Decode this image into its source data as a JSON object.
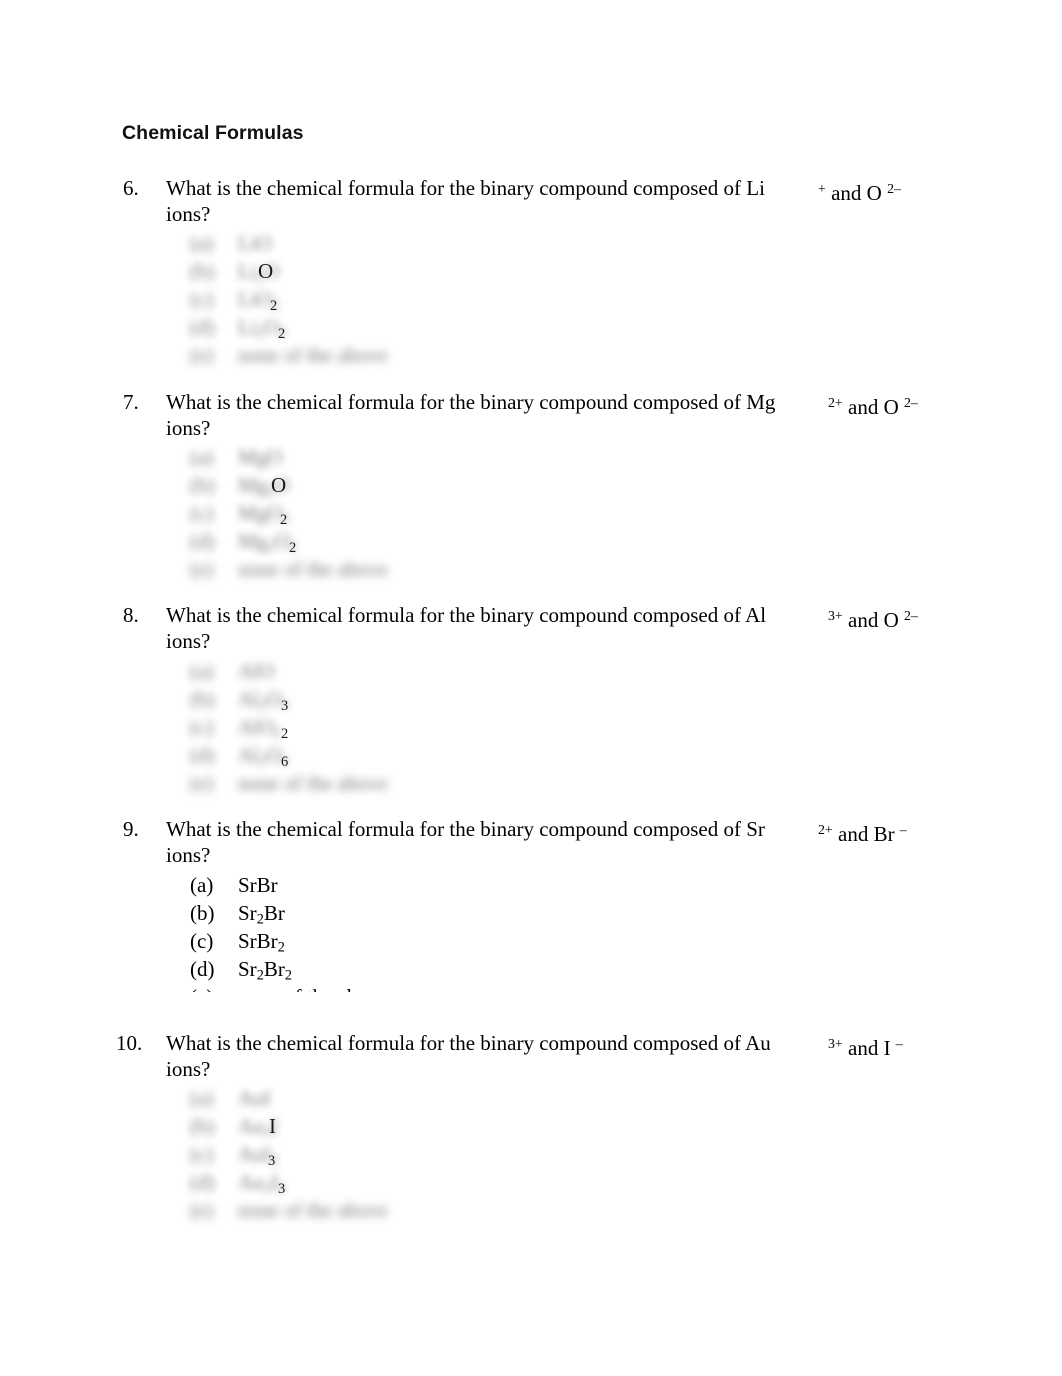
{
  "document": {
    "title": "Chemical Formulas",
    "background_color": "#ffffff",
    "text_color": "#000000"
  },
  "questions": [
    {
      "number": "6.",
      "prompt_line1": "What is the chemical formula for the binary compound composed of Li",
      "prompt_line2": "ions?",
      "ion_cation_symbol": "Li",
      "ion_cation_charge": "+",
      "ion_conjunction": "and O",
      "ion_anion_charge": "2–",
      "ions_text": "+ and O 2–",
      "options": [
        {
          "label": "(a)",
          "value": "LiO",
          "redacted": true,
          "sharp": ""
        },
        {
          "label": "(b)",
          "value": "Li2O",
          "redacted": true,
          "sharp": "O"
        },
        {
          "label": "(c)",
          "value": "LiO2",
          "redacted": true,
          "sharp": "2"
        },
        {
          "label": "(d)",
          "value": "Li2O2",
          "redacted": true,
          "sharp": "2"
        },
        {
          "label": "(e)",
          "value": "none of the above",
          "redacted": true,
          "sharp": ""
        }
      ]
    },
    {
      "number": "7.",
      "prompt_line1": "What is the chemical formula for the binary compound composed of Mg",
      "prompt_line2": "ions?",
      "ion_cation_symbol": "Mg",
      "ion_cation_charge": "2+",
      "ion_conjunction": "and O",
      "ion_anion_charge": "2–",
      "ions_text": "2+ and O 2–",
      "options": [
        {
          "label": "(a)",
          "value": "MgO",
          "redacted": true,
          "sharp": ""
        },
        {
          "label": "(b)",
          "value": "Mg2O",
          "redacted": true,
          "sharp": "O"
        },
        {
          "label": "(c)",
          "value": "MgO2",
          "redacted": true,
          "sharp": "2"
        },
        {
          "label": "(d)",
          "value": "Mg2O2",
          "redacted": true,
          "sharp": "2"
        },
        {
          "label": "(e)",
          "value": "none of the above",
          "redacted": true,
          "sharp": ""
        }
      ]
    },
    {
      "number": "8.",
      "prompt_line1": "What is the chemical formula for the binary compound composed of Al",
      "prompt_line2": "ions?",
      "ion_cation_symbol": "Al",
      "ion_cation_charge": "3+",
      "ion_conjunction": "and O",
      "ion_anion_charge": "2–",
      "ions_text": "3+ and O 2–",
      "options": [
        {
          "label": "(a)",
          "value": "AlO",
          "redacted": true,
          "sharp": ""
        },
        {
          "label": "(b)",
          "value": "Al2O3",
          "redacted": true,
          "sharp": "3"
        },
        {
          "label": "(c)",
          "value": "AlO2",
          "redacted": true,
          "sharp": "2"
        },
        {
          "label": "(d)",
          "value": "Al2O6",
          "redacted": true,
          "sharp": "6"
        },
        {
          "label": "(e)",
          "value": "none of the above",
          "redacted": true,
          "sharp": ""
        }
      ]
    },
    {
      "number": "9.",
      "prompt_line1": "What is the chemical formula for the binary compound composed of Sr",
      "prompt_line2": "ions?",
      "ion_cation_symbol": "Sr",
      "ion_cation_charge": "2+",
      "ion_conjunction": "and Br",
      "ion_anion_charge": "–",
      "ions_text": "2+ and Br –",
      "options": [
        {
          "label": "(a)",
          "value": "SrBr",
          "redacted": false,
          "sharp": ""
        },
        {
          "label": "(b)",
          "value": "Sr2Br",
          "redacted": false,
          "sharp": ""
        },
        {
          "label": "(c)",
          "value": "SrBr2",
          "redacted": false,
          "sharp": ""
        },
        {
          "label": "(d)",
          "value": "Sr2Br2",
          "redacted": false,
          "sharp": ""
        },
        {
          "label": "(e)",
          "value": "none of the above",
          "redacted": false,
          "sharp": "",
          "clipped": true
        }
      ]
    },
    {
      "number": "10.",
      "prompt_line1": "What is the chemical formula for the binary compound composed of Au",
      "prompt_line2": "ions?",
      "ion_cation_symbol": "Au",
      "ion_cation_charge": "3+",
      "ion_conjunction": "and I",
      "ion_anion_charge": "–",
      "ions_text": "3+ and I –",
      "options": [
        {
          "label": "(a)",
          "value": "AuI",
          "redacted": true,
          "sharp": ""
        },
        {
          "label": "(b)",
          "value": "Au3I",
          "redacted": true,
          "sharp": "I"
        },
        {
          "label": "(c)",
          "value": "AuI3",
          "redacted": true,
          "sharp": "3"
        },
        {
          "label": "(d)",
          "value": "Au3I3",
          "redacted": true,
          "sharp": "3"
        },
        {
          "label": "(e)",
          "value": "none of the above",
          "redacted": true,
          "sharp": ""
        }
      ]
    }
  ]
}
